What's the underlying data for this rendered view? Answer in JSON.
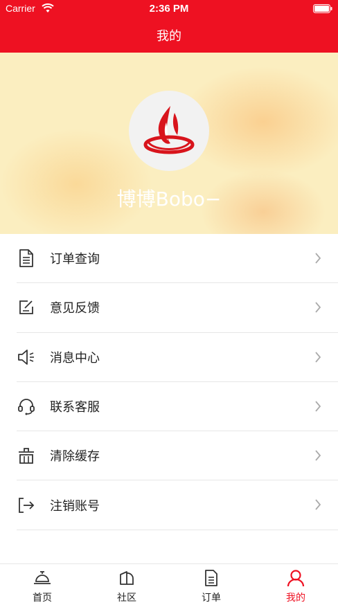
{
  "status_bar": {
    "carrier": "Carrier",
    "time": "2:36 PM"
  },
  "nav": {
    "title": "我的"
  },
  "profile": {
    "username": "博博Bobo−"
  },
  "menu": {
    "items": [
      {
        "label": "订单查询",
        "icon": "document-icon"
      },
      {
        "label": "意见反馈",
        "icon": "feedback-edit-icon"
      },
      {
        "label": "消息中心",
        "icon": "speaker-icon"
      },
      {
        "label": "联系客服",
        "icon": "headset-icon"
      },
      {
        "label": "清除缓存",
        "icon": "trash-icon"
      },
      {
        "label": "注销账号",
        "icon": "logout-icon"
      }
    ]
  },
  "tabbar": {
    "tabs": [
      {
        "label": "首页",
        "icon": "service-bell-icon"
      },
      {
        "label": "社区",
        "icon": "community-icon"
      },
      {
        "label": "订单",
        "icon": "order-document-icon"
      },
      {
        "label": "我的",
        "icon": "user-icon",
        "active": true
      }
    ]
  },
  "colors": {
    "accent": "#ee1122",
    "profile_bg": "#fbeec0"
  }
}
